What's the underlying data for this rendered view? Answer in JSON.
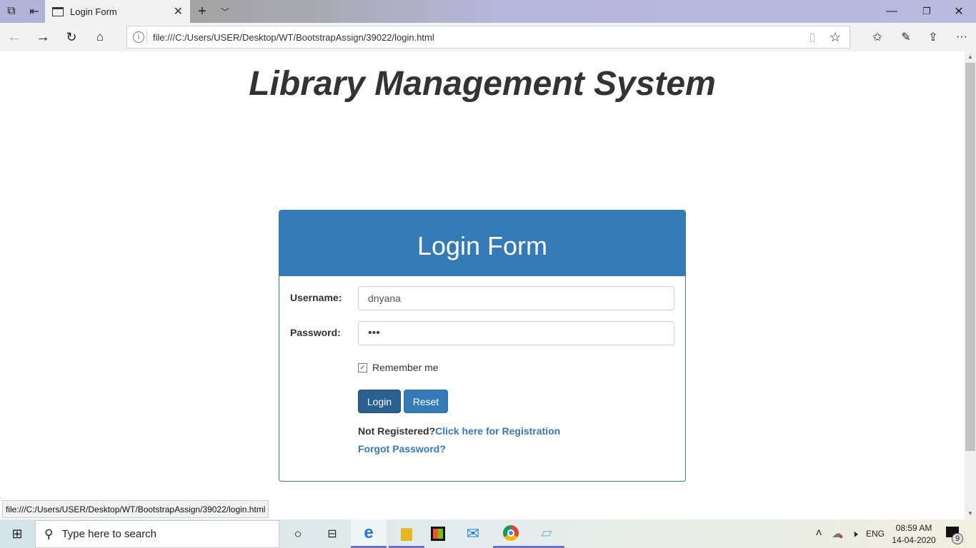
{
  "browser": {
    "tab_title": "Login Form",
    "url": "file:///C:/Users/USER/Desktop/WT/BootstrapAssign/39022/login.html",
    "status_url": "file:///C:/Users/USER/Desktop/WT/BootstrapAssign/39022/login.html"
  },
  "page": {
    "title": "Library Management System"
  },
  "form": {
    "header": "Login Form",
    "username_label": "Username:",
    "username_value": "dnyana",
    "password_label": "Password:",
    "password_value": "•••",
    "remember_label": "Remember me",
    "remember_checked": true,
    "login_label": "Login",
    "reset_label": "Reset",
    "not_registered": "Not Registered?",
    "register_link": "Click here for Registration",
    "forgot_link": "Forgot Password?"
  },
  "taskbar": {
    "search_placeholder": "Type here to search",
    "language": "ENG",
    "time": "08:59 AM",
    "date": "14-04-2020",
    "notifications": "9"
  },
  "colors": {
    "primary": "#337ab7",
    "primary_dark": "#286090"
  }
}
